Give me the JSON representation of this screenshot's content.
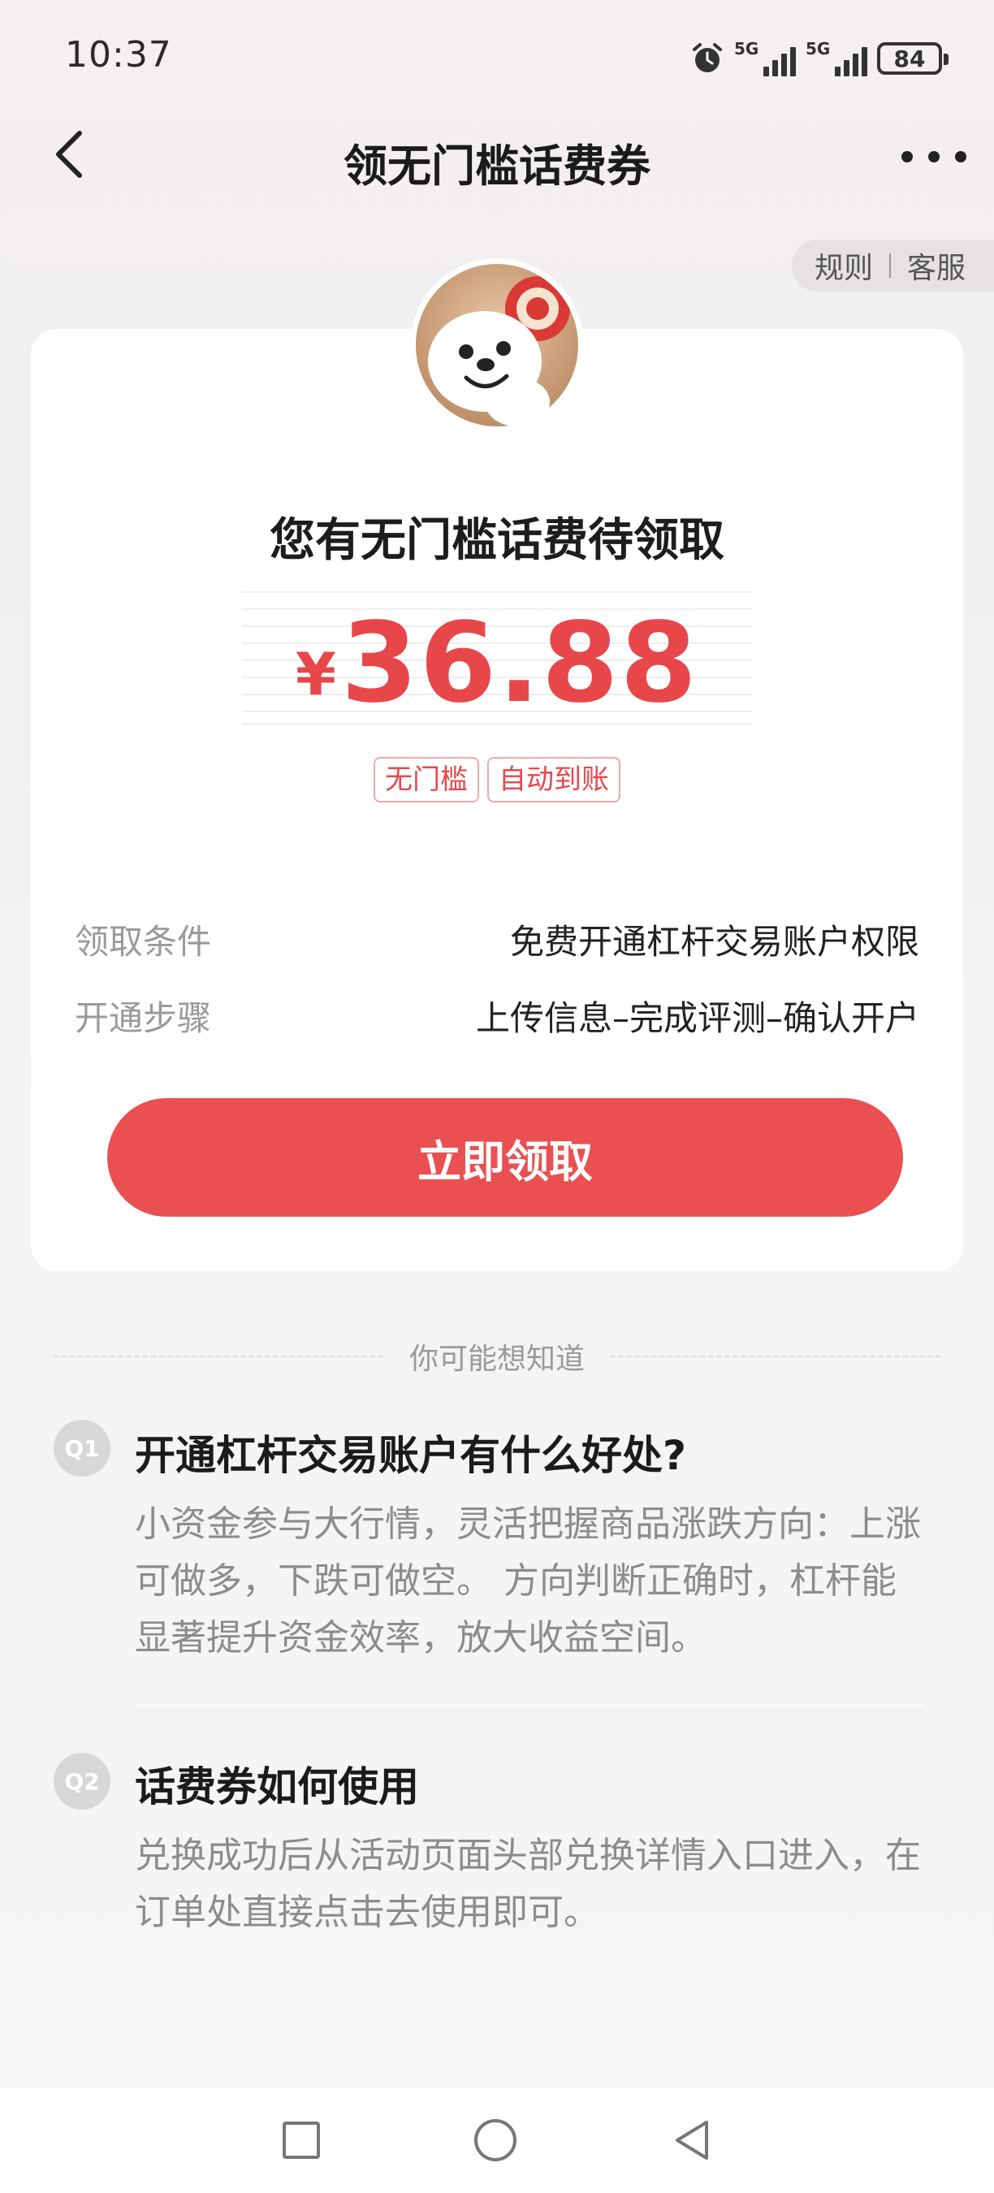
{
  "status_bar": {
    "time": "10:37",
    "signal1_label": "5G",
    "signal2_label": "5G",
    "battery": "84"
  },
  "nav": {
    "title": "领无门槛话费券"
  },
  "links": {
    "rules": "规则",
    "service": "客服"
  },
  "card": {
    "heading": "您有无门槛话费待领取",
    "currency": "¥",
    "amount": "36.88",
    "tags": [
      "无门槛",
      "自动到账"
    ],
    "condition_label": "领取条件",
    "condition_value": "免费开通杠杆交易账户权限",
    "steps_label": "开通步骤",
    "steps_value": "上传信息–完成评测–确认开户",
    "claim_button": "立即领取"
  },
  "faq": {
    "divider": "你可能想知道",
    "items": [
      {
        "badge": "Q1",
        "question": "开通杠杆交易账户有什么好处?",
        "answer": "小资金参与大行情，灵活把握商品涨跌方向：上涨可做多，下跌可做空。 方向判断正确时，杠杆能显著提升资金效率，放大收益空间。"
      },
      {
        "badge": "Q2",
        "question": "话费券如何使用",
        "answer": "兑换成功后从活动页面头部兑换详情入口进入，在订单处直接点击去使用即可。"
      }
    ]
  },
  "colors": {
    "accent": "#ea5051",
    "amount": "#e8474a",
    "muted": "#9a9a9a"
  }
}
